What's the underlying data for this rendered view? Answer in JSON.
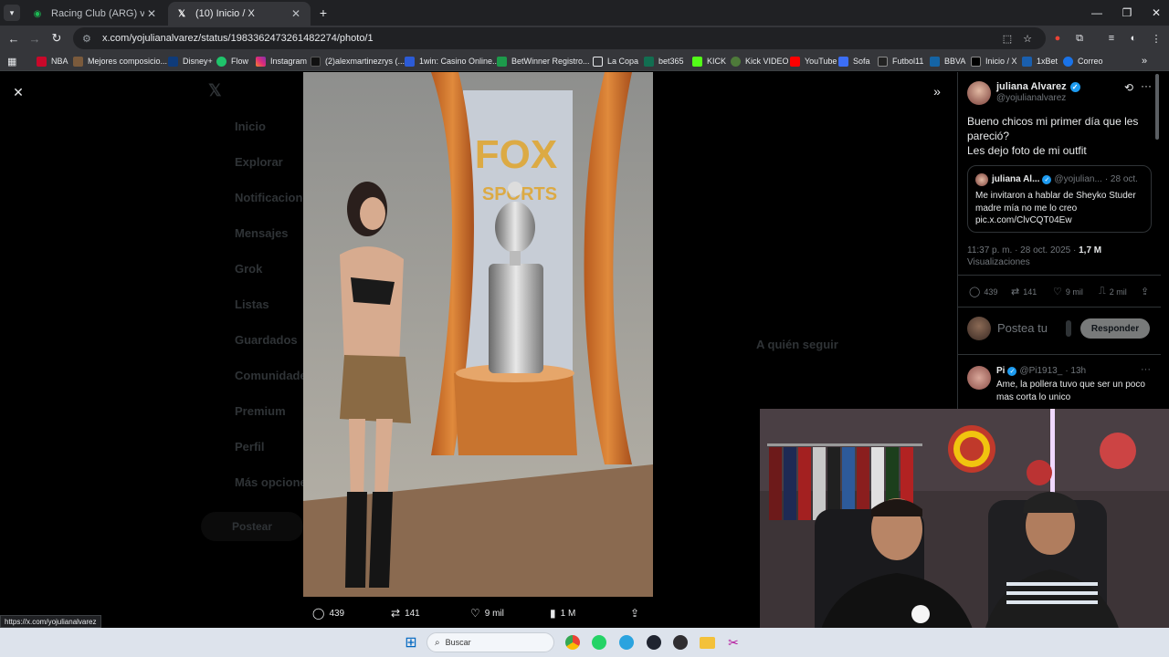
{
  "browser": {
    "tabs": [
      {
        "title": "Racing Club (ARG) vs. Flamengo",
        "active": false
      },
      {
        "title": "(10) Inicio / X",
        "active": true
      }
    ],
    "url": "x.com/yojulianalvarez/status/1983362473261482274/photo/1",
    "bookmarks": [
      "NBA",
      "Mejores composicio...",
      "Disney+",
      "Flow",
      "Instagram",
      "(2)alexmartinezrys (...",
      "1win: Casino Online...",
      "BetWinner Registro...",
      "La Copa",
      "bet365",
      "KICK",
      "Kick VIDEO",
      "YouTube",
      "Sofa",
      "Futbol11",
      "BBVA",
      "Inicio / X",
      "1xBet",
      "Correo"
    ]
  },
  "photo": {
    "sign_text": "FOX SPORTS"
  },
  "photo_actions": {
    "replies": "439",
    "reposts": "141",
    "likes": "9 mil",
    "views": "1 M"
  },
  "tweet": {
    "author_name": "juliana Alvarez",
    "author_handle": "@yojulianalvarez",
    "text_line1": "Bueno chicos mi primer día que les pareció?",
    "text_line2": "Les dejo foto de mi outfit",
    "quote": {
      "name": "juliana Al...",
      "handle": "@yojulian...",
      "date": "· 28 oct.",
      "text": "Me invitaron a hablar de Sheyko Studer madre mía no me lo creo pic.x.com/ClvCQT04Ew"
    },
    "timestamp": "11:37 p. m. · 28 oct. 2025 ·",
    "views_count": "1,7 M",
    "views_label": "Visualizaciones",
    "stats": {
      "replies": "439",
      "reposts": "141",
      "likes": "9 mil",
      "bookmarks": "2 mil"
    },
    "reply_placeholder": "Postea tu",
    "reply_button": "Responder"
  },
  "reply": {
    "name": "Pi",
    "handle": "@Pi1913_",
    "time": "· 13h",
    "text": "Ame, la pollera tuvo que ser un poco mas corta lo unico"
  },
  "status_url": "https://x.com/yojulianalvarez",
  "taskbar": {
    "search_placeholder": "Buscar"
  },
  "ghost_sidebar": [
    "Inicio",
    "Explorar",
    "Notificaciones",
    "Mensajes",
    "Grok",
    "Listas",
    "Guardados",
    "Comunidades",
    "Premium",
    "Perfil",
    "Más opciones"
  ],
  "ghost_post_button": "Postear",
  "ghost_right": {
    "who_to_follow": "A quién seguir"
  }
}
